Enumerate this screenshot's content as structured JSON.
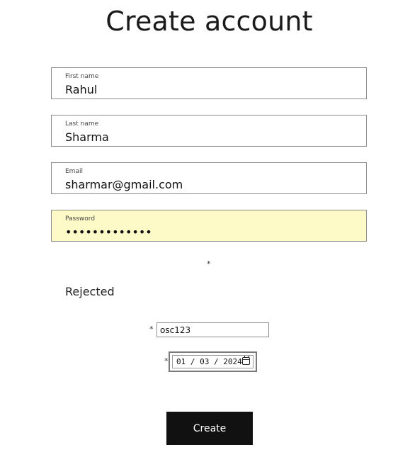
{
  "page": {
    "title": "Create account"
  },
  "form": {
    "first_name": {
      "label": "First name",
      "value": "Rahul"
    },
    "last_name": {
      "label": "Last name",
      "value": "Sharma"
    },
    "email": {
      "label": "Email",
      "value": "sharmar@gmail.com"
    },
    "password": {
      "label": "Password",
      "value": "•••••••••••••"
    },
    "password_asterisk": "*",
    "status_text": "Rejected",
    "code_asterisk": "*",
    "code_value": "osc123",
    "date_asterisk": "*",
    "date_value": "01 / 03 / 2024",
    "submit_label": "Create"
  },
  "colors": {
    "autofill_background": "#fefac8",
    "button_background": "#111111",
    "button_text": "#ffffff"
  },
  "icons": {
    "date_picker": "calendar-icon"
  }
}
